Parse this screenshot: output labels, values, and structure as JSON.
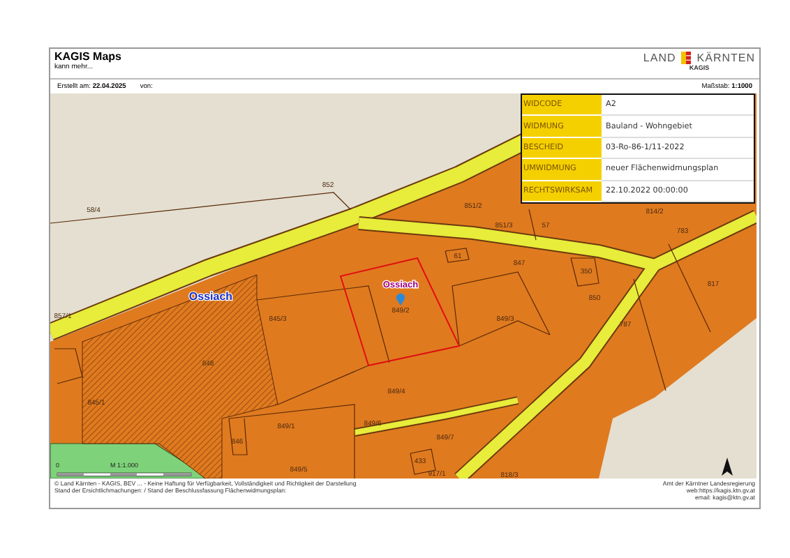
{
  "header": {
    "title": "KAGIS Maps",
    "subtitle": "kann mehr...",
    "logo_left": "LAND",
    "logo_right": "KÄRNTEN",
    "logo_sub": "KAGIS"
  },
  "info": {
    "created_label": "Erstellt am:",
    "created_value": "22.04.2025",
    "by_label": "von:",
    "scale_label": "Maßstab:",
    "scale_value": "1:1000"
  },
  "attributes": [
    {
      "key": "WIDCODE",
      "value": "A2"
    },
    {
      "key": "WIDMUNG",
      "value": "Bauland - Wohngebiet"
    },
    {
      "key": "BESCHEID",
      "value": "03-Ro-86-1/11-2022"
    },
    {
      "key": "UMWIDMUNG",
      "value": "neuer Flächenwidmungsplan"
    },
    {
      "key": "RECHTSWIRKSAM",
      "value": "22.10.2022 00:00:00"
    }
  ],
  "map": {
    "labels": [
      {
        "kind": "parcel",
        "text": "58/4"
      },
      {
        "kind": "parcel",
        "text": "852"
      },
      {
        "kind": "parcel",
        "text": "857/1"
      },
      {
        "kind": "place",
        "text": "Ossiach"
      },
      {
        "kind": "parcel",
        "text": "845/3"
      },
      {
        "kind": "parcel",
        "text": "848"
      },
      {
        "kind": "parcel",
        "text": "845/1"
      },
      {
        "kind": "parcel",
        "text": "849/1"
      },
      {
        "kind": "parcel",
        "text": "846"
      },
      {
        "kind": "parcel",
        "text": "849/5"
      },
      {
        "kind": "parcel",
        "text": "851/2"
      },
      {
        "kind": "parcel",
        "text": "851/3"
      },
      {
        "kind": "parcel",
        "text": "57"
      },
      {
        "kind": "parcel",
        "text": "814/2"
      },
      {
        "kind": "parcel",
        "text": "783"
      },
      {
        "kind": "parcel",
        "text": "61"
      },
      {
        "kind": "parcel",
        "text": "847"
      },
      {
        "kind": "parcel",
        "text": "350"
      },
      {
        "kind": "pin",
        "text": "Ossiach"
      },
      {
        "kind": "parcel",
        "text": "849/2"
      },
      {
        "kind": "parcel",
        "text": "850"
      },
      {
        "kind": "parcel",
        "text": "849/3"
      },
      {
        "kind": "parcel",
        "text": "817"
      },
      {
        "kind": "parcel",
        "text": "787"
      },
      {
        "kind": "parcel",
        "text": "849/4"
      },
      {
        "kind": "parcel",
        "text": "849/6"
      },
      {
        "kind": "parcel",
        "text": "849/7"
      },
      {
        "kind": "parcel",
        "text": "433"
      },
      {
        "kind": "parcel",
        "text": "917/1"
      },
      {
        "kind": "parcel",
        "text": "818/3"
      }
    ],
    "scale_bar": {
      "start": "0",
      "label": "M 1:1.000"
    }
  },
  "footer": {
    "left": [
      "© Land Kärnten - KAGIS, BEV ... - Keine Haftung für Verfügbarkeit, Vollständigkeit und Richtigkeit der Darstellung",
      "Stand der Ersichtlichmachungen: / Stand der Beschlussfassung Flächenwidmungsplan:"
    ],
    "right": [
      "Amt der Kärntner Landesregierung",
      "web:https://kagis.ktn.gv.at",
      "email: kagis@ktn.gv.at"
    ]
  }
}
